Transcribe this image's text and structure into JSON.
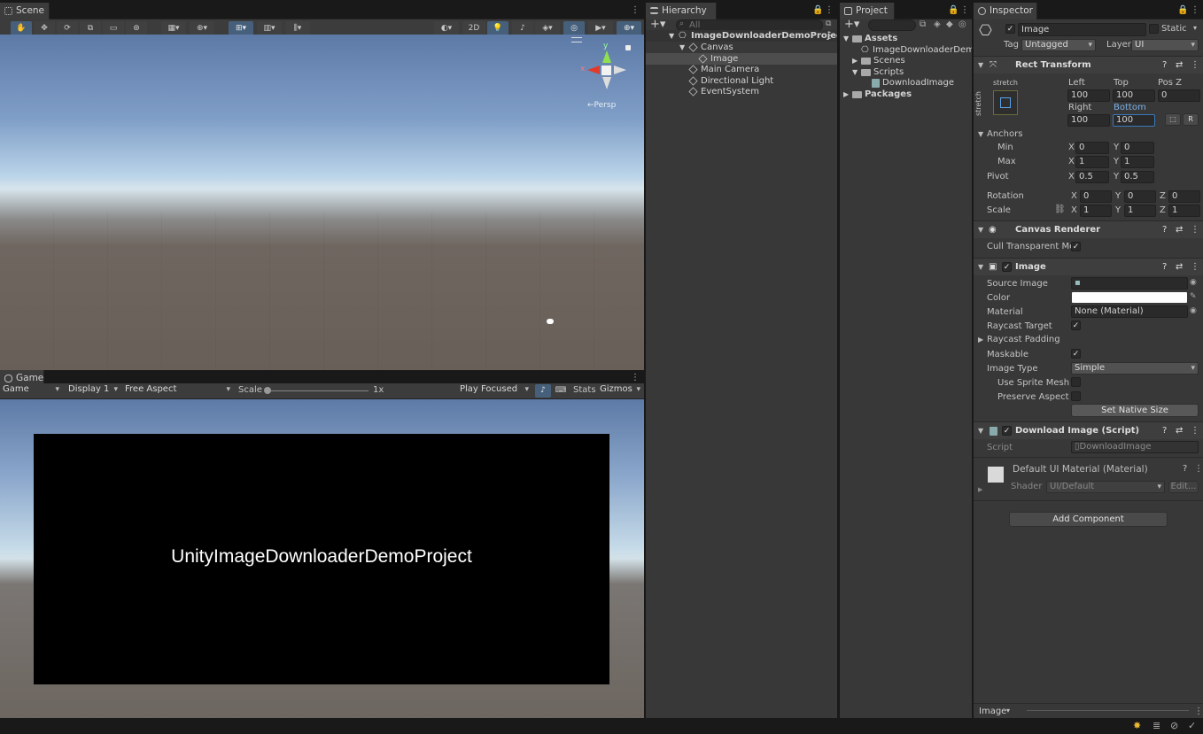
{
  "scene": {
    "tab": "Scene",
    "toolbar": {
      "mode_2d": "2D"
    },
    "gizmo": {
      "y": "y",
      "x": "x",
      "persp": "←Persp"
    }
  },
  "game": {
    "tab": "Game",
    "view_select": "Game",
    "display": "Display 1",
    "aspect": "Free Aspect",
    "scale_label": "Scale",
    "scale_value": "1x",
    "play_mode": "Play Focused",
    "stats": "Stats",
    "gizmos": "Gizmos",
    "canvas_text": "UnityImageDownloaderDemoProject"
  },
  "hierarchy": {
    "tab": "Hierarchy",
    "search_placeholder": "All",
    "items": [
      {
        "label": "ImageDownloaderDemoProject"
      },
      {
        "label": "Canvas"
      },
      {
        "label": "Image"
      },
      {
        "label": "Main Camera"
      },
      {
        "label": "Directional Light"
      },
      {
        "label": "EventSystem"
      }
    ]
  },
  "project": {
    "tab": "Project",
    "items": [
      {
        "label": "Assets"
      },
      {
        "label": "ImageDownloaderDemoP"
      },
      {
        "label": "Scenes"
      },
      {
        "label": "Scripts"
      },
      {
        "label": "DownloadImage"
      },
      {
        "label": "Packages"
      }
    ]
  },
  "inspector": {
    "tab": "Inspector",
    "object_name": "Image",
    "static_label": "Static",
    "tag_label": "Tag",
    "tag_value": "Untagged",
    "layer_label": "Layer",
    "layer_value": "UI",
    "rect_transform": {
      "title": "Rect Transform",
      "stretch": "stretch",
      "left_label": "Left",
      "left": "100",
      "top_label": "Top",
      "top": "100",
      "posz_label": "Pos Z",
      "posz": "0",
      "right_label": "Right",
      "right": "100",
      "bottom_label": "Bottom",
      "bottom": "100",
      "r_button": "R",
      "anchors": "Anchors",
      "min": "Min",
      "min_x": "0",
      "min_y": "0",
      "max": "Max",
      "max_x": "1",
      "max_y": "1",
      "pivot": "Pivot",
      "pivot_x": "0.5",
      "pivot_y": "0.5",
      "rotation": "Rotation",
      "rot_x": "0",
      "rot_y": "0",
      "rot_z": "0",
      "scale": "Scale",
      "scale_x": "1",
      "scale_y": "1",
      "scale_z": "1",
      "X": "X",
      "Y": "Y",
      "Z": "Z"
    },
    "canvas_renderer": {
      "title": "Canvas Renderer",
      "cull": "Cull Transparent Mes"
    },
    "image": {
      "title": "Image",
      "source_image": "Source Image",
      "color": "Color",
      "color_value": "#ffffff",
      "material": "Material",
      "material_value": "None (Material)",
      "raycast_target": "Raycast Target",
      "raycast_padding": "Raycast Padding",
      "maskable": "Maskable",
      "image_type": "Image Type",
      "image_type_value": "Simple",
      "use_sprite_mesh": "Use Sprite Mesh",
      "preserve_aspect": "Preserve Aspect",
      "set_native_size": "Set Native Size"
    },
    "download_image": {
      "title": "Download Image (Script)",
      "script_label": "Script",
      "script_value": "DownloadImage"
    },
    "material": {
      "title": "Default UI Material (Material)",
      "shader_label": "Shader",
      "shader_value": "UI/Default",
      "edit": "Edit..."
    },
    "add_component": "Add Component",
    "footer": "Image"
  },
  "colors": {
    "accent": "#46607c",
    "selection": "#4d4d4d"
  }
}
